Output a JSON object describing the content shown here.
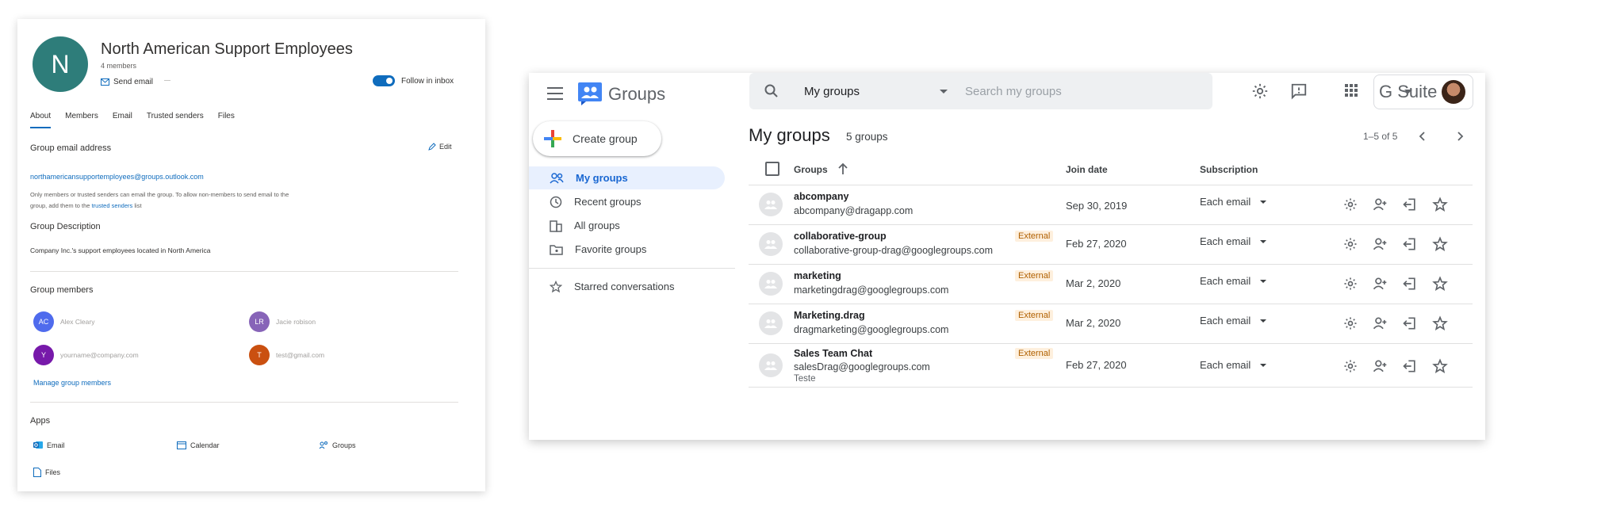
{
  "outlook_group": {
    "avatar_letter": "N",
    "title": "North American Support Employees",
    "members_count": "4 members",
    "send_email": "Send email",
    "follow_label": "Follow in inbox",
    "tabs": [
      "About",
      "Members",
      "Email",
      "Trusted senders",
      "Files"
    ],
    "active_tab": "About",
    "email_section_label": "Group email address",
    "edit_label": "Edit",
    "group_email": "northamericansupportemployees@groups.outlook.com",
    "email_note_1": "Only members or trusted senders can email the group. To allow non-members to send email to the",
    "email_note_2a": "group, add them to the",
    "email_note_link": "trusted senders",
    "email_note_2b": "list",
    "description_label": "Group Description",
    "description": "Company Inc.'s support employees located in North America",
    "members_label": "Group members",
    "members": [
      {
        "initials": "AC",
        "name": "Alex Cleary",
        "color": "#4f6bed"
      },
      {
        "initials": "LR",
        "name": "Jacie robison",
        "color": "#8764b8"
      },
      {
        "initials": "Y",
        "name": "yourname@company.com",
        "color": "#7719aa"
      },
      {
        "initials": "T",
        "name": "test@gmail.com",
        "color": "#ca5010"
      }
    ],
    "manage_link": "Manage group members",
    "apps_label": "Apps",
    "apps": [
      "Email",
      "Calendar",
      "Groups",
      "Files"
    ]
  },
  "google_groups": {
    "app_name": "Groups",
    "search_scope": "My groups",
    "search_placeholder": "Search my groups",
    "brand": "G Suite",
    "create_button": "Create group",
    "nav": [
      "My groups",
      "Recent groups",
      "All groups",
      "Favorite groups"
    ],
    "nav_starred": "Starred conversations",
    "heading": "My groups",
    "group_count": "5 groups",
    "paging": "1–5 of 5",
    "columns": {
      "groups": "Groups",
      "join_date": "Join date",
      "subscription": "Subscription"
    },
    "rows": [
      {
        "name": "abcompany",
        "email": "abcompany@dragapp.com",
        "external": "",
        "date": "Sep 30, 2019",
        "subscription": "Each email",
        "description": ""
      },
      {
        "name": "collaborative-group",
        "email": "collaborative-group-drag@googlegroups.com",
        "external": "External",
        "date": "Feb 27, 2020",
        "subscription": "Each email",
        "description": ""
      },
      {
        "name": "marketing",
        "email": "marketingdrag@googlegroups.com",
        "external": "External",
        "date": "Mar 2, 2020",
        "subscription": "Each email",
        "description": ""
      },
      {
        "name": "Marketing.drag",
        "email": "dragmarketing@googlegroups.com",
        "external": "External",
        "date": "Mar 2, 2020",
        "subscription": "Each email",
        "description": ""
      },
      {
        "name": "Sales Team Chat",
        "email": "salesDrag@googlegroups.com",
        "external": "External",
        "date": "Feb 27, 2020",
        "subscription": "Each email",
        "description": "Teste"
      }
    ],
    "colors": {
      "accent": "#1967d2",
      "nav_active_bg": "#e8f0fe",
      "external_bg": "#fef0de",
      "external_text": "#b06000"
    }
  }
}
